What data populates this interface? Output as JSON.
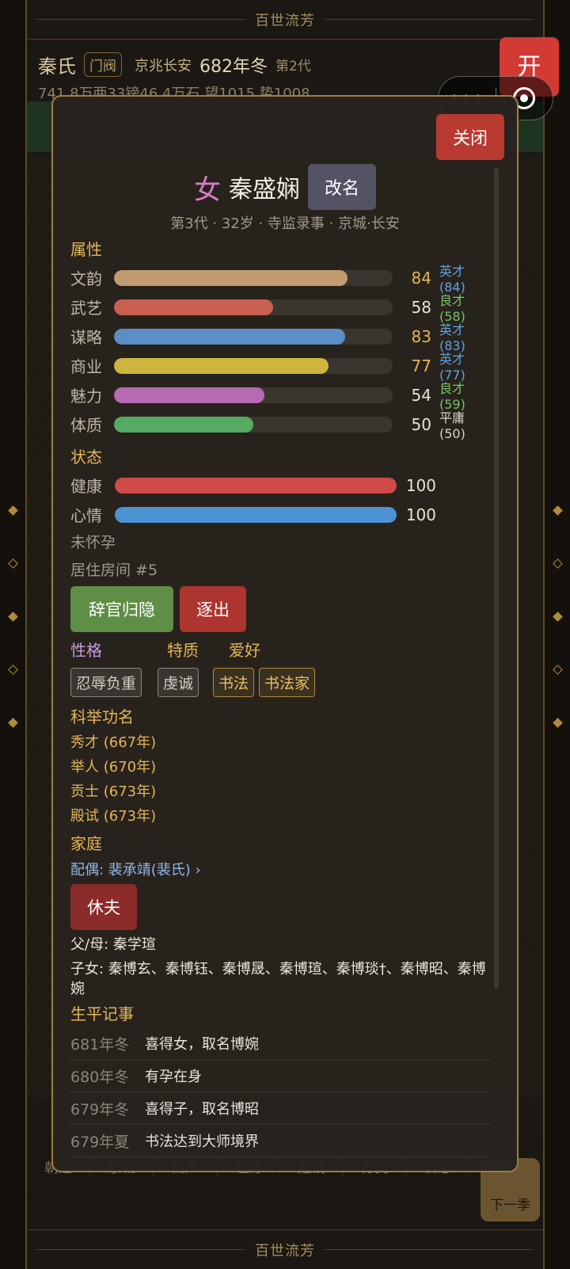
{
  "background": {
    "banner": "百世流芳",
    "clan_name": "秦氏",
    "clan_tag": "门阀",
    "location": "京兆长安",
    "season": "682年冬",
    "generation": "第2代",
    "resources": "741.8万两33镑46.4万石 望1015 势1008",
    "nav_tabs": [
      "朝廷",
      "京城",
      "田产",
      "理财",
      "建设",
      "分支",
      "日志"
    ],
    "next_button": "下一季",
    "open_button": "开",
    "capsule_more": "•••"
  },
  "modal": {
    "close_label": "关闭",
    "gender": "女",
    "name": "秦盛娴",
    "rename_label": "改名",
    "subtitle": "第3代 · 32岁 · 寺监录事 · 京城·长安",
    "attributes_title": "属性",
    "attributes": [
      {
        "label": "文韵",
        "value": "84",
        "grade": "英才(84)",
        "fill": 0.84,
        "color": "#c29b70"
      },
      {
        "label": "武艺",
        "value": "58",
        "grade": "良才(58)",
        "fill": 0.57,
        "color": "#c86150"
      },
      {
        "label": "谋略",
        "value": "83",
        "grade": "英才(83)",
        "fill": 0.83,
        "color": "#5b8ec6"
      },
      {
        "label": "商业",
        "value": "77",
        "grade": "英才(77)",
        "fill": 0.77,
        "color": "#cdb63d"
      },
      {
        "label": "魅力",
        "value": "54",
        "grade": "良才(59)",
        "fill": 0.54,
        "color": "#b56ab2"
      },
      {
        "label": "体质",
        "value": "50",
        "grade": "平庸(50)",
        "fill": 0.5,
        "color": "#56ab63"
      }
    ],
    "status_title": "状态",
    "status": [
      {
        "label": "健康",
        "value": "100",
        "fill": 1.0,
        "color": "#cf4b48"
      },
      {
        "label": "心情",
        "value": "100",
        "fill": 1.0,
        "color": "#4c93d3"
      }
    ],
    "pregnancy": "未怀孕",
    "room": "居住房间 #5",
    "resign_label": "辞官归隐",
    "expel_label": "逐出",
    "personality_title": "性格",
    "trait_title": "特质",
    "hobby_title": "爱好",
    "personality_tag": "忍辱负重",
    "trait_tag": "虔诚",
    "hobby_tags": [
      "书法",
      "书法家"
    ],
    "exam_title": "科举功名",
    "exams": [
      "秀才 (667年)",
      "举人 (670年)",
      "贡士 (673年)",
      "殿试 (673年)"
    ],
    "family_title": "家庭",
    "spouse": "配偶: 裴承靖(裴氏) ›",
    "divorce_label": "休夫",
    "parents": "父/母: 秦学瑄",
    "children": "子女: 秦博玄、秦博钰、秦博晟、秦博瑄、秦博琰†、秦博昭、秦博婉",
    "events_title": "生平记事",
    "events": [
      {
        "season": "681年冬",
        "text": "喜得女，取名博婉"
      },
      {
        "season": "680年冬",
        "text": "有孕在身"
      },
      {
        "season": "679年冬",
        "text": "喜得子，取名博昭"
      },
      {
        "season": "679年夏",
        "text": "书法达到大师境界"
      }
    ]
  },
  "colors": {
    "gold": "#e2b657",
    "purple_title": "#c79be2",
    "blue_grade": "#5fa4e0",
    "green_grade": "#77c267",
    "modal_border": "#9c7f48"
  }
}
